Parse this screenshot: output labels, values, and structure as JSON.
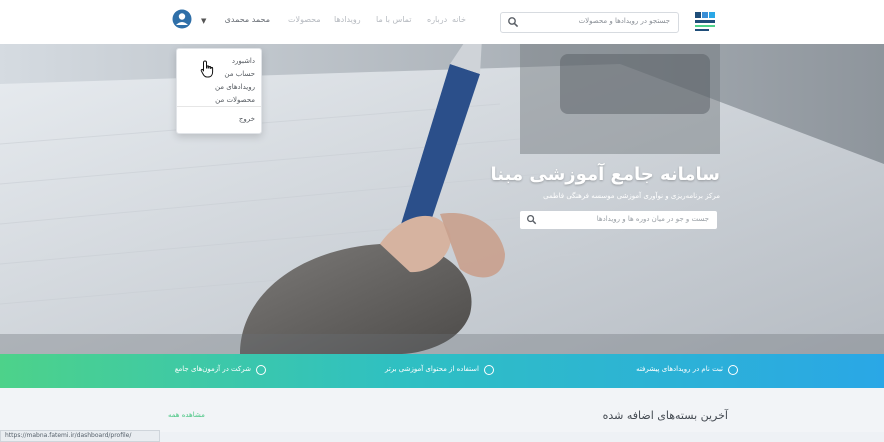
{
  "header": {
    "search_placeholder": "جستجو در رویدادها و محصولات",
    "nav": [
      "خانه",
      "درباره",
      "تماس با ما",
      "رویدادها",
      "محصولات"
    ],
    "user_name": "محمد محمدی"
  },
  "user_menu": {
    "items": [
      "داشبورد",
      "حساب من",
      "رویدادهای من",
      "محصولات من"
    ],
    "logout": "خروج"
  },
  "hero": {
    "title": "سامانه جامع آموزشی مبنا",
    "subtitle": "مرکز برنامه‌ریزی و نوآوری آموزشی موسسه فرهنگی فاطمی",
    "search_placeholder": "جست و جو در میان دوره ها و رویدادها"
  },
  "features": [
    "ثبت نام در رویدادهای پیشرفته",
    "استفاده از محتوای آموزشی برتر",
    "شرکت در آزمون‌های جامع"
  ],
  "section": {
    "title": "آخرین بسته‌های اضافه شده",
    "view_all": "مشاهده همه"
  },
  "status_url": "https://mabna.fatemi.ir/dashboard/profile/",
  "colors": {
    "accent_green": "#4dd28a",
    "accent_blue": "#2aa7e6",
    "primary_dark": "#1f4e79"
  }
}
